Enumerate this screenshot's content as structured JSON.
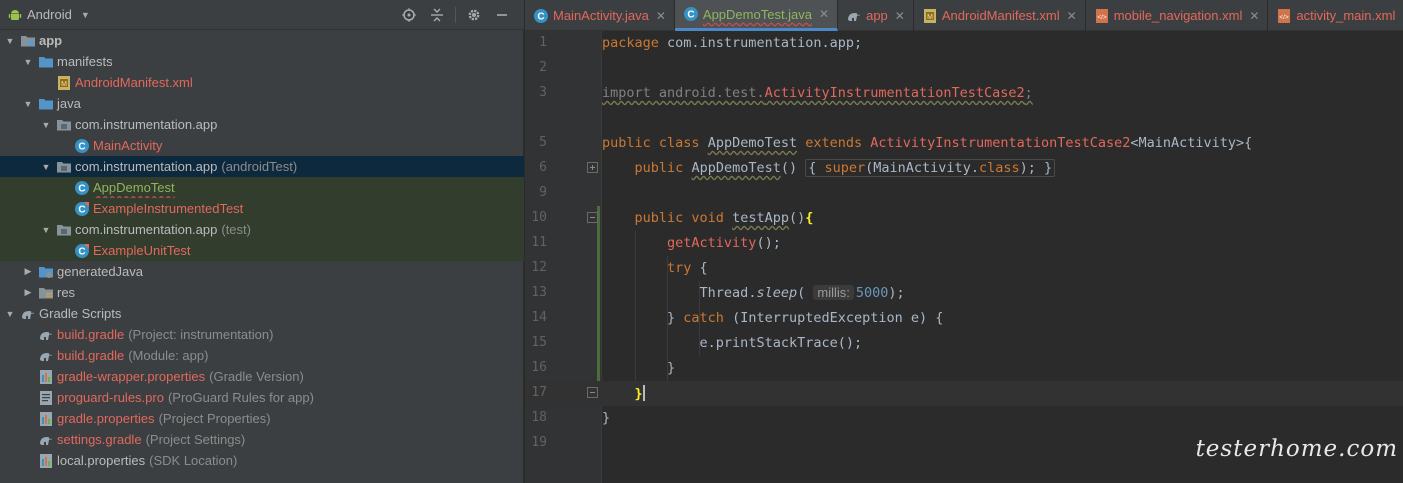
{
  "project_panel": {
    "view_mode": "Android",
    "tools": [
      "crosshair-icon",
      "collapse-icon",
      "gear-icon",
      "minimize-icon"
    ],
    "tree": [
      {
        "label": "app",
        "hint": "",
        "depth": 0,
        "expanded": true,
        "icon": "module-folder-icon",
        "style": "bold"
      },
      {
        "label": "manifests",
        "hint": "",
        "depth": 1,
        "expanded": true,
        "icon": "folder-icon",
        "style": "normal"
      },
      {
        "label": "AndroidManifest.xml",
        "hint": "",
        "depth": 2,
        "expanded": null,
        "icon": "manifest-file-icon",
        "style": "red"
      },
      {
        "label": "java",
        "hint": "",
        "depth": 1,
        "expanded": true,
        "icon": "folder-icon",
        "style": "normal"
      },
      {
        "label": "com.instrumentation.app",
        "hint": "",
        "depth": 2,
        "expanded": true,
        "icon": "package-icon",
        "style": "normal"
      },
      {
        "label": "MainActivity",
        "hint": "",
        "depth": 3,
        "expanded": null,
        "icon": "class-icon",
        "style": "red"
      },
      {
        "label": "com.instrumentation.app",
        "hint": "(androidTest)",
        "depth": 2,
        "expanded": true,
        "icon": "package-icon",
        "style": "normal",
        "selected": true
      },
      {
        "label": "AppDemoTest",
        "hint": "",
        "depth": 3,
        "expanded": null,
        "icon": "class-icon",
        "style": "green",
        "testbg": true
      },
      {
        "label": "ExampleInstrumentedTest",
        "hint": "",
        "depth": 3,
        "expanded": null,
        "icon": "test-class-icon",
        "style": "red",
        "testbg": true
      },
      {
        "label": "com.instrumentation.app",
        "hint": "(test)",
        "depth": 2,
        "expanded": true,
        "icon": "package-icon",
        "style": "normal",
        "testbg": true
      },
      {
        "label": "ExampleUnitTest",
        "hint": "",
        "depth": 3,
        "expanded": null,
        "icon": "test-class-icon",
        "style": "red",
        "testbg": true
      },
      {
        "label": "generatedJava",
        "hint": "",
        "depth": 1,
        "expanded": false,
        "icon": "generated-folder-icon",
        "style": "normal"
      },
      {
        "label": "res",
        "hint": "",
        "depth": 1,
        "expanded": false,
        "icon": "res-folder-icon",
        "style": "normal"
      },
      {
        "label": "Gradle Scripts",
        "hint": "",
        "depth": 0,
        "expanded": true,
        "icon": "gradle-icon",
        "style": "normal"
      },
      {
        "label": "build.gradle",
        "hint": "(Project: instrumentation)",
        "depth": 1,
        "expanded": null,
        "icon": "gradle-icon",
        "style": "red"
      },
      {
        "label": "build.gradle",
        "hint": "(Module: app)",
        "depth": 1,
        "expanded": null,
        "icon": "gradle-icon",
        "style": "red"
      },
      {
        "label": "gradle-wrapper.properties",
        "hint": "(Gradle Version)",
        "depth": 1,
        "expanded": null,
        "icon": "properties-file-icon",
        "style": "red"
      },
      {
        "label": "proguard-rules.pro",
        "hint": "(ProGuard Rules for app)",
        "depth": 1,
        "expanded": null,
        "icon": "text-file-icon",
        "style": "red"
      },
      {
        "label": "gradle.properties",
        "hint": "(Project Properties)",
        "depth": 1,
        "expanded": null,
        "icon": "properties-file-icon",
        "style": "red"
      },
      {
        "label": "settings.gradle",
        "hint": "(Project Settings)",
        "depth": 1,
        "expanded": null,
        "icon": "gradle-icon",
        "style": "red"
      },
      {
        "label": "local.properties",
        "hint": "(SDK Location)",
        "depth": 1,
        "expanded": null,
        "icon": "properties-file-icon",
        "style": "normal"
      }
    ]
  },
  "tabs": [
    {
      "label": "MainActivity.java",
      "icon": "class-icon",
      "active": false
    },
    {
      "label": "AppDemoTest.java",
      "icon": "class-icon",
      "active": true
    },
    {
      "label": "app",
      "icon": "gradle-icon",
      "active": false
    },
    {
      "label": "AndroidManifest.xml",
      "icon": "manifest-file-icon",
      "active": false
    },
    {
      "label": "mobile_navigation.xml",
      "icon": "xml-file-icon",
      "active": false
    },
    {
      "label": "activity_main.xml",
      "icon": "xml-file-icon",
      "active": false
    }
  ],
  "editor": {
    "line_numbers": [
      "1",
      "2",
      "3",
      "5",
      "6",
      "9",
      "10",
      "11",
      "12",
      "13",
      "14",
      "15",
      "16",
      "17",
      "18",
      "19"
    ],
    "current_line": "17",
    "lines": {
      "l1": {
        "kw": "package",
        "rest": " com.instrumentation.app;"
      },
      "l3": {
        "kw": "import",
        "rest": " android.test.",
        "err": "ActivityInstrumentationTestCase2",
        "end": ";"
      },
      "l5": {
        "kw1": "public class",
        "name": "AppDemoTest",
        "kw2": "extends",
        "err": "ActivityInstrumentationTestCase2",
        "rest": "<MainActivity>{"
      },
      "l6": {
        "kw": "public",
        "name": "AppDemoTest",
        "paren": "()",
        "fold": "{ super(MainActivity.class); }",
        "super_kw": "super",
        "super_rest": "(MainActivity.",
        "class_kw": "class",
        "super_end": ");"
      },
      "l10": {
        "kw": "public void",
        "name": "testApp",
        "paren": "()",
        "brace": "{"
      },
      "l11": {
        "call": "getActivity",
        "rest": "();"
      },
      "l12": {
        "kw": "try",
        "rest": " {"
      },
      "l13": {
        "obj": "Thread.",
        "meth": "sleep",
        "open": "(",
        "hint": "millis:",
        "num": "5000",
        "close": ");"
      },
      "l14": {
        "pre": "} ",
        "kw": "catch",
        "rest": " (InterruptedException e) {"
      },
      "l15": {
        "text": "e.printStackTrace();"
      },
      "l16": {
        "text": "}"
      },
      "l17": {
        "brace": "}"
      },
      "l18": {
        "text": "}"
      }
    }
  },
  "watermark": "testerhome.com"
}
